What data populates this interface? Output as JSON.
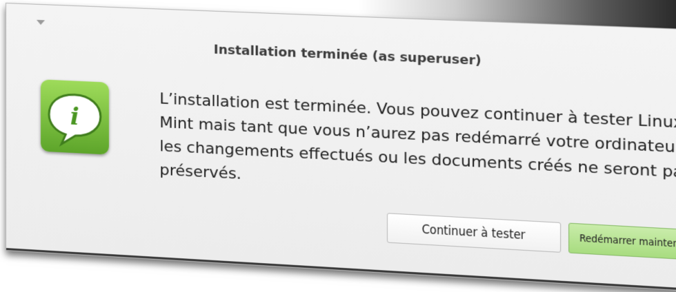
{
  "dialog": {
    "title": "Installation terminée (as superuser)",
    "close_label": "×",
    "message": "L’installation est terminée. Vous pouvez continuer à tester Linux Mint mais tant que vous n’aurez pas redémarré votre ordinateur les changements effectués ou les documents créés ne seront pas préservés.",
    "icon": "info-speech-bubble-icon",
    "icon_color": "#6bbf3a",
    "buttons": {
      "continue_label": "Continuer à tester",
      "restart_label": "Redémarrer maintenant"
    },
    "accent_color": "#a8dc80"
  }
}
